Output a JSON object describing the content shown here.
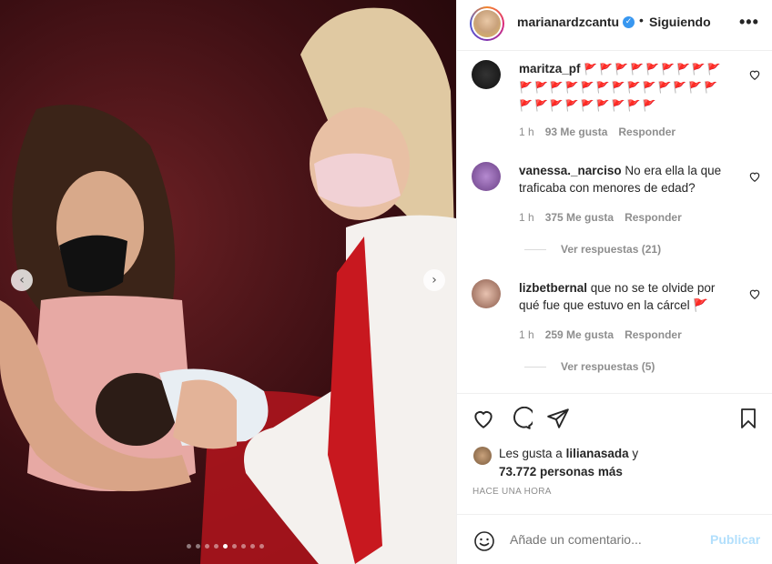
{
  "header": {
    "username": "marianardzcantu",
    "separator": "•",
    "follow_status": "Siguiendo",
    "more": "•••",
    "verified_glyph": "✓"
  },
  "photo": {
    "prev_glyph": "‹",
    "next_glyph": "›",
    "dots_count": 9,
    "active_dot": 4
  },
  "comments": [
    {
      "username": "maritza_pf",
      "text": "🚩🚩🚩🚩🚩🚩🚩🚩🚩🚩🚩🚩🚩🚩🚩🚩🚩🚩🚩🚩🚩🚩🚩🚩🚩🚩🚩🚩🚩🚩🚩",
      "time": "1 h",
      "likes": "93 Me gusta",
      "reply": "Responder"
    },
    {
      "username": "vanessa._narciso",
      "text": "No era ella la que traficaba con menores de edad?",
      "time": "1 h",
      "likes": "375 Me gusta",
      "reply": "Responder",
      "view_replies": "Ver respuestas (21)"
    },
    {
      "username": "lizbetbernal",
      "text": "que no se te olvide por qué fue que estuvo en la cárcel 🚩",
      "time": "1 h",
      "likes": "259 Me gusta",
      "reply": "Responder",
      "view_replies": "Ver respuestas (5)"
    }
  ],
  "likes": {
    "prefix": "Les gusta a",
    "user": "lilianasada",
    "and": "y",
    "others": "73.772 personas más"
  },
  "timestamp": "HACE UNA HORA",
  "add_comment": {
    "placeholder": "Añade un comentario...",
    "publish": "Publicar"
  },
  "colors": {
    "accent": "#0095f6",
    "publish_disabled": "#b2dffc",
    "meta": "#8e8e8e",
    "flag": "#d7263d"
  }
}
